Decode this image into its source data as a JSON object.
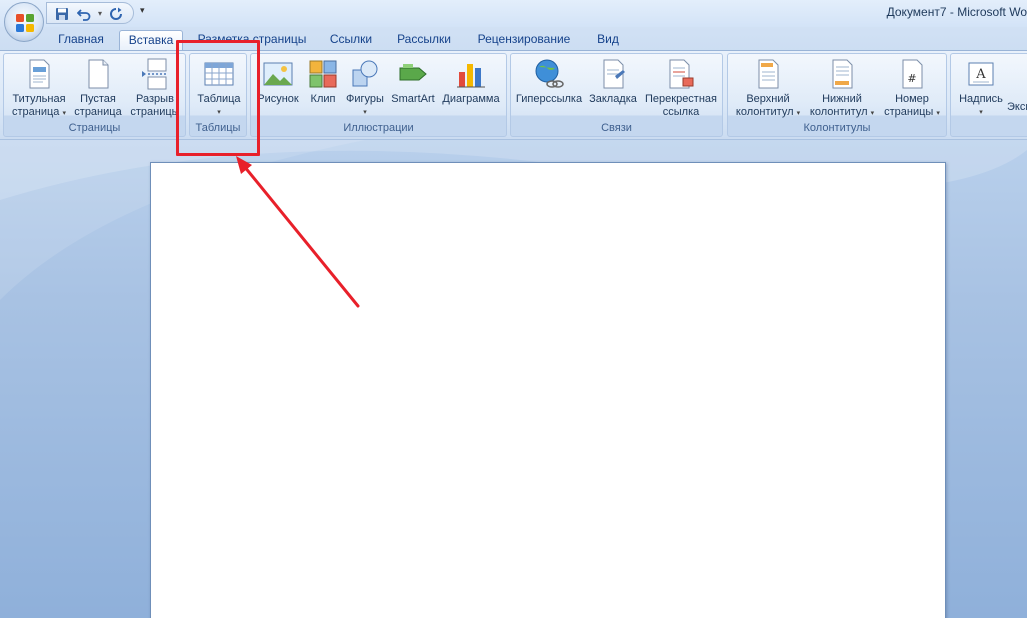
{
  "window": {
    "title": "Документ7 - Microsoft Wo"
  },
  "quick_access": {
    "save_icon": "save-icon",
    "undo_icon": "undo-icon",
    "redo_icon": "redo-icon",
    "customize_glyph": "▾"
  },
  "tabs": [
    {
      "label": "Главная"
    },
    {
      "label": "Вставка",
      "active": true
    },
    {
      "label": "Разметка страницы"
    },
    {
      "label": "Ссылки"
    },
    {
      "label": "Рассылки"
    },
    {
      "label": "Рецензирование"
    },
    {
      "label": "Вид"
    }
  ],
  "ribbon": {
    "groups": {
      "pages": {
        "label": "Страницы",
        "buttons": [
          {
            "line1": "Титульная",
            "line2": "страница",
            "dropdown": "▾"
          },
          {
            "line1": "Пустая",
            "line2": "страница"
          },
          {
            "line1": "Разрыв",
            "line2": "страницы"
          }
        ]
      },
      "tables": {
        "label": "Таблицы",
        "buttons": [
          {
            "line1": "Таблица",
            "dropdown": "▾"
          }
        ]
      },
      "illustrations": {
        "label": "Иллюстрации",
        "buttons": [
          {
            "line1": "Рисунок"
          },
          {
            "line1": "Клип"
          },
          {
            "line1": "Фигуры",
            "dropdown": "▾"
          },
          {
            "line1": "SmartArt"
          },
          {
            "line1": "Диаграмма"
          }
        ]
      },
      "links": {
        "label": "Связи",
        "buttons": [
          {
            "line1": "Гиперссылка"
          },
          {
            "line1": "Закладка"
          },
          {
            "line1": "Перекрестная",
            "line2": "ссылка"
          }
        ]
      },
      "header_footer": {
        "label": "Колонтитулы",
        "buttons": [
          {
            "line1": "Верхний",
            "line2": "колонтитул",
            "dropdown": "▾"
          },
          {
            "line1": "Нижний",
            "line2": "колонтитул",
            "dropdown": "▾"
          },
          {
            "line1": "Номер",
            "line2": "страницы",
            "dropdown": "▾"
          }
        ]
      },
      "text": {
        "buttons": [
          {
            "line1": "Надпись",
            "dropdown": "▾"
          },
          {
            "line1": "Эксп"
          }
        ]
      }
    }
  },
  "colors": {
    "annotation": "#e8202a",
    "ribbon_text": "#1e395b",
    "group_label": "#3e5f8e"
  }
}
